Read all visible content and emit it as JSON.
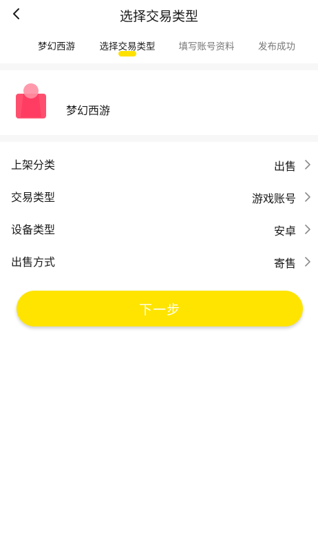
{
  "header": {
    "title": "选择交易类型",
    "back_icon": "chevron-left-icon"
  },
  "steps": [
    {
      "label": "梦幻西游",
      "state": "done"
    },
    {
      "label": "选择交易类型",
      "state": "active"
    },
    {
      "label": "填写账号资料",
      "state": "pending"
    },
    {
      "label": "发布成功",
      "state": "pending"
    }
  ],
  "game": {
    "name": "梦幻西游",
    "icon": "shopping-bag-icon",
    "icon_color": "#ff4f6e"
  },
  "options": [
    {
      "label": "上架分类",
      "value": "出售"
    },
    {
      "label": "交易类型",
      "value": "游戏账号"
    },
    {
      "label": "设备类型",
      "value": "安卓"
    },
    {
      "label": "出售方式",
      "value": "寄售"
    }
  ],
  "next_button": {
    "label": "下一步",
    "color": "#ffe400"
  },
  "colors": {
    "accent": "#ffe100",
    "brand_pink": "#ff4f6e"
  }
}
